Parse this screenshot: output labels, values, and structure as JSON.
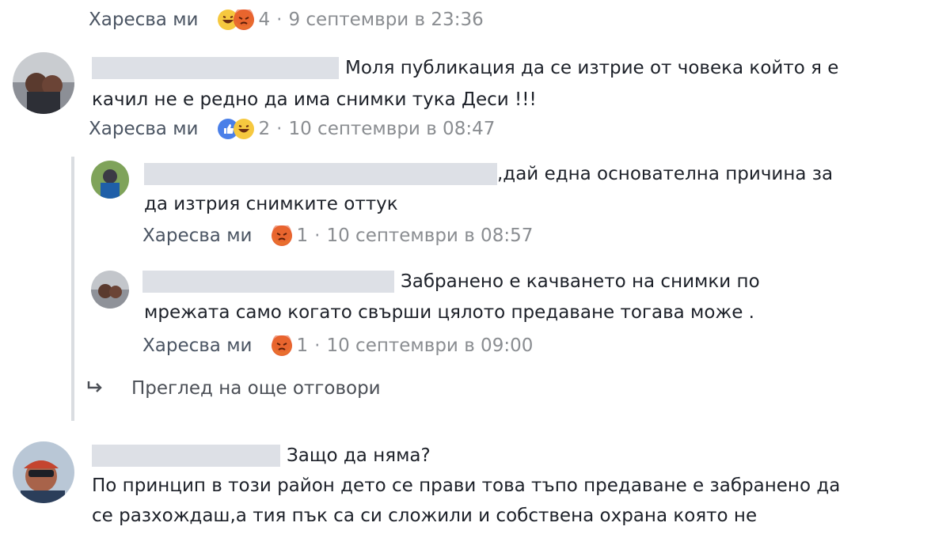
{
  "comments": [
    {
      "meta": {
        "like_label": "Харесва ми",
        "reaction_count": "4",
        "timestamp": "9 септември в 23:36",
        "reactions": [
          "haha-icon",
          "angry-icon"
        ]
      }
    },
    {
      "text_lines": [
        "Моля публикация да се изтрие от човека който я е",
        "качил не е редно да има снимки тука Деси !!!"
      ],
      "meta": {
        "like_label": "Харесва ми",
        "reaction_count": "2",
        "timestamp": "10 септември в 08:47",
        "reactions": [
          "like-icon",
          "haha-icon"
        ]
      }
    },
    {
      "text_lines": [
        ",дай една основателна причина за",
        "да изтрия снимките оттук"
      ],
      "meta": {
        "like_label": "Харесва ми",
        "reaction_count": "1",
        "timestamp": "10 септември в 08:57",
        "reactions": [
          "angry-icon"
        ]
      }
    },
    {
      "text_lines": [
        "Забранено е качването на снимки по",
        "мрежата само когато свърши цялото предаване тогава може ."
      ],
      "meta": {
        "like_label": "Харесва ми",
        "reaction_count": "1",
        "timestamp": "10 септември в 09:00",
        "reactions": [
          "angry-icon"
        ]
      }
    },
    {
      "text_lines": [
        "Защо да няма?",
        "По принцип в този район дето се прави това тъпо предаване е забранено да",
        "се разхождаш,а тия пък са си сложили и собствена охрана която не"
      ]
    }
  ],
  "view_more_replies": "Преглед на още отговори",
  "meta_separator": "·",
  "colors": {
    "text": "#1d2129",
    "meta": "#5f6672",
    "redaction": "#dde0e6",
    "like_blue": "#4a7fe8",
    "angry_orange": "#e85d2e",
    "haha_yellow": "#f6c83f"
  }
}
